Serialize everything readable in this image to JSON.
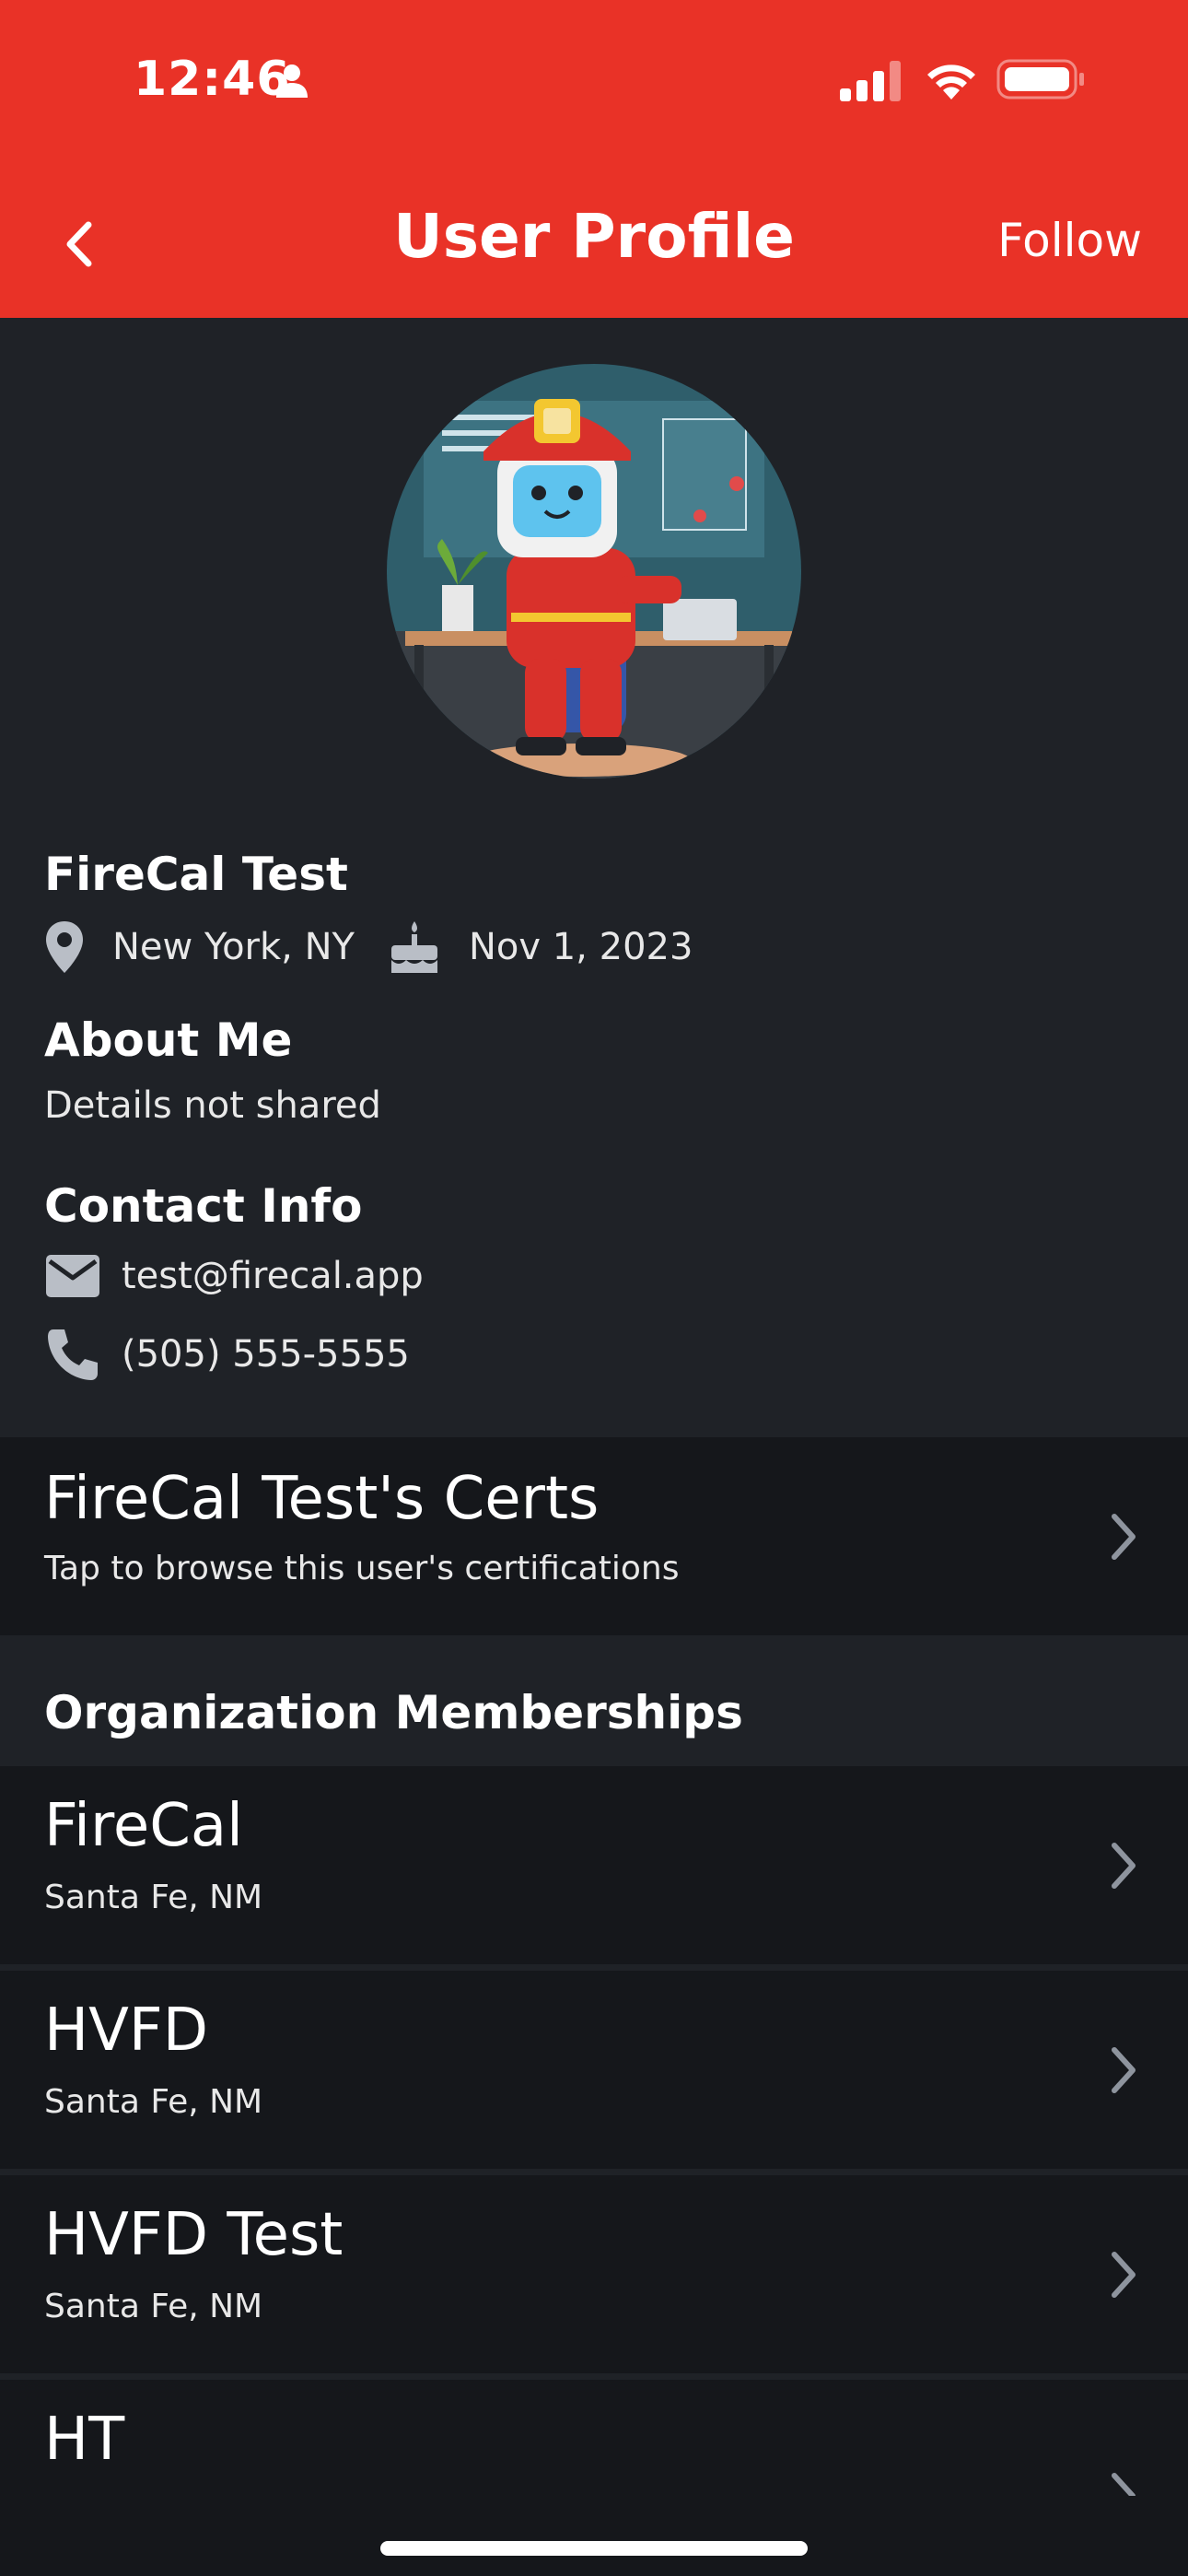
{
  "status": {
    "time": "12:46"
  },
  "nav": {
    "title": "User Profile",
    "follow_label": "Follow"
  },
  "profile": {
    "name": "FireCal Test",
    "location": "New York, NY",
    "birthday": "Nov 1, 2023",
    "about_title": "About Me",
    "about_text": "Details not shared",
    "contact_title": "Contact Info",
    "email": "test@firecal.app",
    "phone": "(505) 555-5555"
  },
  "certs": {
    "title": "FireCal Test's Certs",
    "subtitle": "Tap to browse this user's certifications"
  },
  "memberships": {
    "header": "Organization Memberships",
    "items": [
      {
        "name": "FireCal",
        "location": "Santa Fe, NM"
      },
      {
        "name": "HVFD",
        "location": "Santa Fe, NM"
      },
      {
        "name": "HVFD Test",
        "location": "Santa Fe, NM"
      },
      {
        "name": "HT",
        "location": ""
      }
    ]
  },
  "colors": {
    "header_bg": "#e93227",
    "page_bg": "#1f2227",
    "row_bg": "#15171b",
    "chevron": "#8e949e"
  },
  "icons": [
    "person-icon",
    "signal-icon",
    "wifi-icon",
    "battery-icon",
    "back-icon",
    "location-pin-icon",
    "cake-icon",
    "email-icon",
    "phone-icon",
    "chevron-right-icon"
  ]
}
